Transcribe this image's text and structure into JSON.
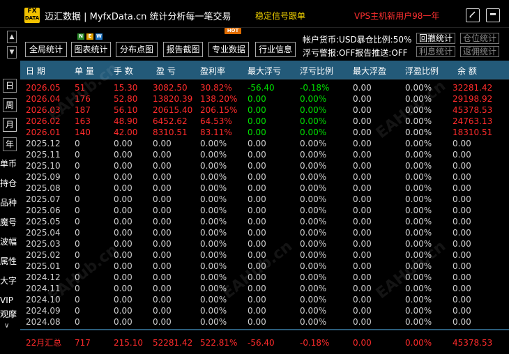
{
  "titlebar": {
    "logo_line1": "FX",
    "logo_line2": "DATA",
    "title": "迈汇数据 | MyfxData.cn  统计分析每一笔交易",
    "signal_link": "稳定信号跟单",
    "vps_link": "VPS主机新用户98一年",
    "edit_icon": "edit-icon",
    "minimize_icon": "minimize-icon"
  },
  "nav_arrows": {
    "up": "▲",
    "down": "▼"
  },
  "period_buttons": [
    "日",
    "周",
    "月",
    "年"
  ],
  "side_items": [
    "单币",
    "持仓",
    "品种",
    "魔号",
    "波幅",
    "属性",
    "大字",
    "VIP",
    "观摩"
  ],
  "side_more": "∨",
  "toolbar": {
    "buttons": [
      "全局统计",
      "图表统计",
      "分布点图",
      "报告截图",
      "专业数据",
      "行业信息"
    ],
    "new_badge": [
      "N",
      "E",
      "W"
    ],
    "hot_badge": "HOT"
  },
  "account_info": {
    "line1": "帐户货币:USD暴仓比例:50%",
    "line2": "浮亏警报:OFF报告推送:OFF",
    "revoke_btn": "回撤统计",
    "position_btn": "仓位统计",
    "interest_btn": "利息统计",
    "rebate_btn": "返佣统计"
  },
  "table": {
    "headers": [
      "日 期",
      "单 量",
      "手 数",
      "盈 亏",
      "盈利率",
      "最大浮亏",
      "浮亏比例",
      "最大浮盈",
      "浮盈比例",
      "余 额"
    ],
    "rows": [
      [
        "2026.05",
        "51",
        "15.30",
        "3082.50",
        "30.82%",
        "-56.40",
        "-0.18%",
        "0.00",
        "0.00%",
        "32281.42"
      ],
      [
        "2026.04",
        "176",
        "52.80",
        "13820.39",
        "138.20%",
        "0.00",
        "0.00%",
        "0.00",
        "0.00%",
        "29198.92"
      ],
      [
        "2026.03",
        "187",
        "56.10",
        "20615.40",
        "206.15%",
        "0.00",
        "0.00%",
        "0.00",
        "0.00%",
        "45378.53"
      ],
      [
        "2026.02",
        "163",
        "48.90",
        "6452.62",
        "64.53%",
        "0.00",
        "0.00%",
        "0.00",
        "0.00%",
        "24763.13"
      ],
      [
        "2026.01",
        "140",
        "42.00",
        "8310.51",
        "83.11%",
        "0.00",
        "0.00%",
        "0.00",
        "0.00%",
        "18310.51"
      ],
      [
        "2025.12",
        "0",
        "0.00",
        "0.00",
        "0.00%",
        "0.00",
        "0.00%",
        "0.00",
        "0.00%",
        "0.00"
      ],
      [
        "2025.11",
        "0",
        "0.00",
        "0.00",
        "0.00%",
        "0.00",
        "0.00%",
        "0.00",
        "0.00%",
        "0.00"
      ],
      [
        "2025.10",
        "0",
        "0.00",
        "0.00",
        "0.00%",
        "0.00",
        "0.00%",
        "0.00",
        "0.00%",
        "0.00"
      ],
      [
        "2025.09",
        "0",
        "0.00",
        "0.00",
        "0.00%",
        "0.00",
        "0.00%",
        "0.00",
        "0.00%",
        "0.00"
      ],
      [
        "2025.08",
        "0",
        "0.00",
        "0.00",
        "0.00%",
        "0.00",
        "0.00%",
        "0.00",
        "0.00%",
        "0.00"
      ],
      [
        "2025.07",
        "0",
        "0.00",
        "0.00",
        "0.00%",
        "0.00",
        "0.00%",
        "0.00",
        "0.00%",
        "0.00"
      ],
      [
        "2025.06",
        "0",
        "0.00",
        "0.00",
        "0.00%",
        "0.00",
        "0.00%",
        "0.00",
        "0.00%",
        "0.00"
      ],
      [
        "2025.05",
        "0",
        "0.00",
        "0.00",
        "0.00%",
        "0.00",
        "0.00%",
        "0.00",
        "0.00%",
        "0.00"
      ],
      [
        "2025.04",
        "0",
        "0.00",
        "0.00",
        "0.00%",
        "0.00",
        "0.00%",
        "0.00",
        "0.00%",
        "0.00"
      ],
      [
        "2025.03",
        "0",
        "0.00",
        "0.00",
        "0.00%",
        "0.00",
        "0.00%",
        "0.00",
        "0.00%",
        "0.00"
      ],
      [
        "2025.02",
        "0",
        "0.00",
        "0.00",
        "0.00%",
        "0.00",
        "0.00%",
        "0.00",
        "0.00%",
        "0.00"
      ],
      [
        "2025.01",
        "0",
        "0.00",
        "0.00",
        "0.00%",
        "0.00",
        "0.00%",
        "0.00",
        "0.00%",
        "0.00"
      ],
      [
        "2024.12",
        "0",
        "0.00",
        "0.00",
        "0.00%",
        "0.00",
        "0.00%",
        "0.00",
        "0.00%",
        "0.00"
      ],
      [
        "2024.11",
        "0",
        "0.00",
        "0.00",
        "0.00%",
        "0.00",
        "0.00%",
        "0.00",
        "0.00%",
        "0.00"
      ],
      [
        "2024.10",
        "0",
        "0.00",
        "0.00",
        "0.00%",
        "0.00",
        "0.00%",
        "0.00",
        "0.00%",
        "0.00"
      ],
      [
        "2024.09",
        "0",
        "0.00",
        "0.00",
        "0.00%",
        "0.00",
        "0.00%",
        "0.00",
        "0.00%",
        "0.00"
      ],
      [
        "2024.08",
        "0",
        "0.00",
        "0.00",
        "0.00%",
        "0.00",
        "0.00%",
        "0.00",
        "0.00%",
        "0.00"
      ]
    ],
    "footer": [
      "22月汇总",
      "717",
      "215.10",
      "52281.42",
      "522.81%",
      "-56.40",
      "-0.18%",
      "0.00",
      "0.00%",
      "45378.53"
    ]
  },
  "watermark_text": "EAHub.cn",
  "colors": {
    "header_bg": "#235a79",
    "profit_red": "#ff2b2b",
    "float_green": "#00e000",
    "signal_yellow": "#f2d200"
  }
}
